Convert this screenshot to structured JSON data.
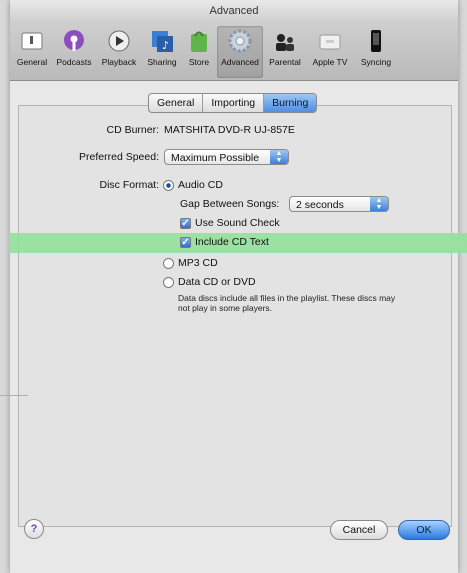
{
  "window": {
    "title": "Advanced"
  },
  "toolbar": {
    "items": [
      {
        "label": "General",
        "icon": "general-icon"
      },
      {
        "label": "Podcasts",
        "icon": "podcasts-icon"
      },
      {
        "label": "Playback",
        "icon": "playback-icon"
      },
      {
        "label": "Sharing",
        "icon": "sharing-icon"
      },
      {
        "label": "Store",
        "icon": "store-icon"
      },
      {
        "label": "Advanced",
        "icon": "advanced-icon",
        "selected": true
      },
      {
        "label": "Parental",
        "icon": "parental-icon"
      },
      {
        "label": "Apple TV",
        "icon": "apple-tv-icon"
      },
      {
        "label": "Syncing",
        "icon": "syncing-icon"
      }
    ]
  },
  "tabs": [
    {
      "label": "General"
    },
    {
      "label": "Importing"
    },
    {
      "label": "Burning",
      "active": true
    }
  ],
  "burning": {
    "cd_burner_label": "CD Burner:",
    "cd_burner_value": "MATSHITA DVD-R   UJ-857E",
    "preferred_speed_label": "Preferred Speed:",
    "preferred_speed_value": "Maximum Possible",
    "disc_format_label": "Disc Format:",
    "audio_cd_label": "Audio CD",
    "gap_label": "Gap Between Songs:",
    "gap_value": "2 seconds",
    "use_sound_check_label": "Use Sound Check",
    "include_cd_text_label": "Include CD Text",
    "mp3_cd_label": "MP3 CD",
    "data_cd_label": "Data CD or DVD",
    "data_note": "Data discs include all files in the playlist. These discs may not play in some players."
  },
  "footer": {
    "help_label": "?",
    "cancel_label": "Cancel",
    "ok_label": "OK"
  },
  "colors": {
    "highlight": "#98e0a0",
    "accent": "#3f7fd8"
  }
}
